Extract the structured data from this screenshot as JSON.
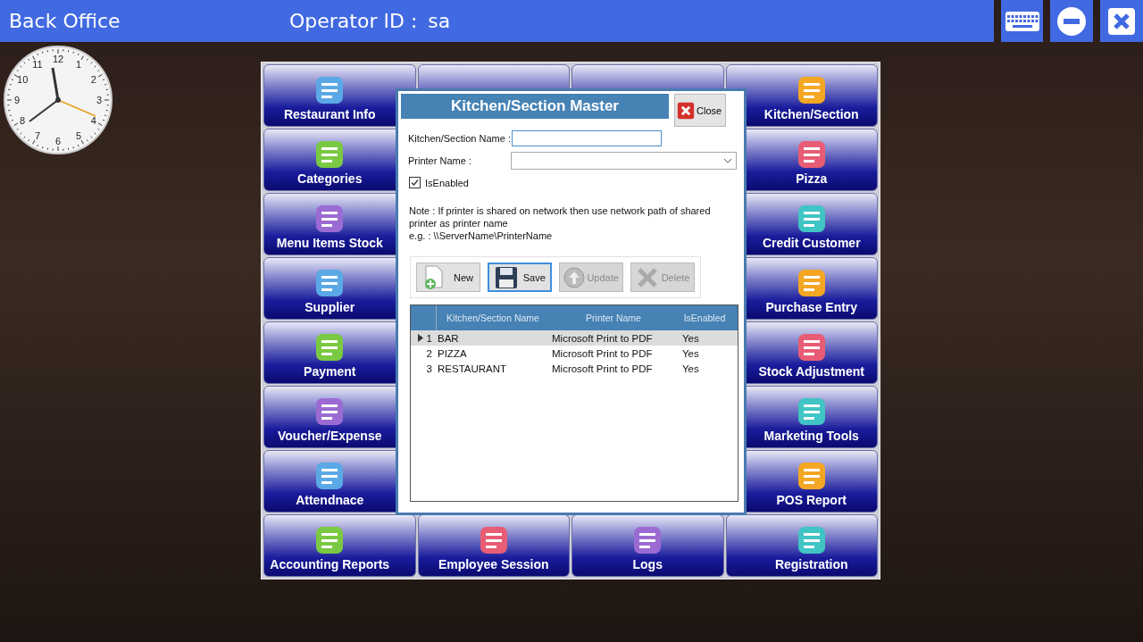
{
  "header": {
    "title": "Back Office",
    "operator_label": "Operator ID :",
    "operator": "sa"
  },
  "clock": {
    "numbers": [
      "12",
      "1",
      "2",
      "3",
      "4",
      "5",
      "6",
      "7",
      "8",
      "9",
      "10",
      "11"
    ]
  },
  "tiles": [
    {
      "label": "Restaurant Info"
    },
    {
      "label": "Kitchen/Section"
    },
    {
      "label": "Categories"
    },
    {
      "label": "Pizza"
    },
    {
      "label": "Menu Items Stock"
    },
    {
      "label": "Credit Customer"
    },
    {
      "label": "Supplier"
    },
    {
      "label": "Purchase Entry"
    },
    {
      "label": "Payment"
    },
    {
      "label": "Stock Adjustment"
    },
    {
      "label": "Voucher/Expense"
    },
    {
      "label": "Marketing Tools"
    },
    {
      "label": "Attendnace"
    },
    {
      "label": "POS Report"
    },
    {
      "label": "Accounting Reports"
    },
    {
      "label": "Employee Session"
    },
    {
      "label": "Logs"
    },
    {
      "label": "Registration"
    }
  ],
  "dialog": {
    "title": "Kitchen/Section Master",
    "close": "Close",
    "name_label": "Kitchen/Section Name :",
    "printer_label": "Printer Name :",
    "enabled": {
      "label": "IsEnabled",
      "checked": true
    },
    "note": "Note : If printer is shared on network then use network path of shared printer as printer name",
    "example": "e.g. : \\\\ServerName\\PrinterName",
    "buttons": [
      {
        "label": "New",
        "kind": "new",
        "disabled": false,
        "focused": false
      },
      {
        "label": "Save",
        "kind": "save",
        "disabled": false,
        "focused": true
      },
      {
        "label": "Update",
        "kind": "update",
        "disabled": true,
        "focused": false
      },
      {
        "label": "Delete",
        "kind": "delete",
        "disabled": true,
        "focused": false
      }
    ],
    "table": {
      "columns": [
        "Kitchen/Section Name",
        "Printer Name",
        "IsEnabled"
      ],
      "rows": [
        {
          "index": "1",
          "name": "BAR",
          "printer": "Microsoft Print to PDF",
          "enabled": "Yes",
          "selected": true
        },
        {
          "index": "2",
          "name": "PIZZA",
          "printer": "Microsoft Print to PDF",
          "enabled": "Yes",
          "selected": false
        },
        {
          "index": "3",
          "name": "RESTAURANT",
          "printer": "Microsoft Print to PDF",
          "enabled": "Yes",
          "selected": false
        }
      ]
    }
  }
}
